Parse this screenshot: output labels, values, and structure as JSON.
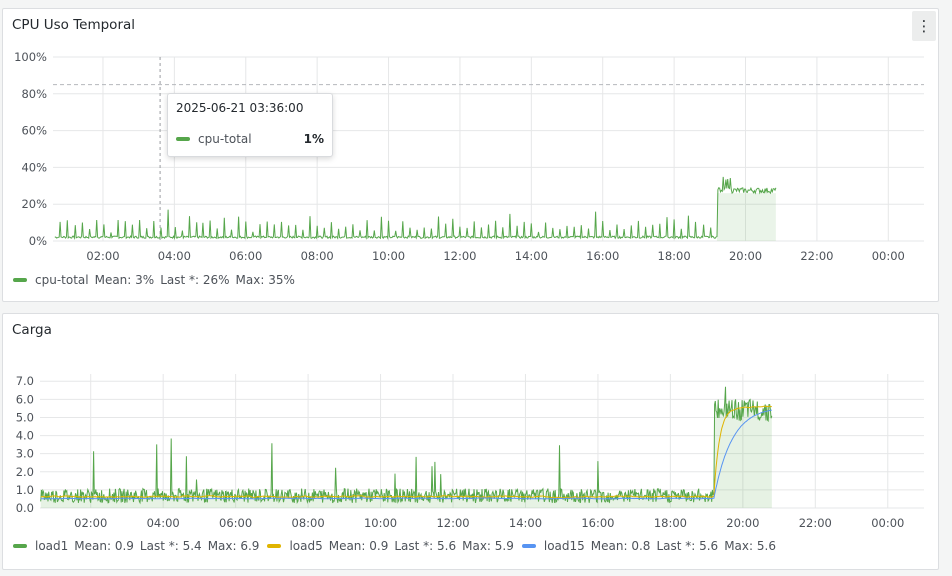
{
  "panel1": {
    "title": "CPU Uso Temporal",
    "menu_icon": "vertical-dots-icon",
    "tooltip": {
      "time": "2025-06-21 03:36:00",
      "series": "cpu-total",
      "value": "1%"
    },
    "legend": [
      {
        "name": "cpu-total",
        "color": "#56a64b",
        "mean": "Mean: 3%",
        "last": "Last *: 26%",
        "max": "Max: 35%"
      }
    ]
  },
  "panel2": {
    "title": "Carga",
    "legend": [
      {
        "name": "load1",
        "color": "#56a64b",
        "mean": "Mean: 0.9",
        "last": "Last *: 5.4",
        "max": "Max: 6.9"
      },
      {
        "name": "load5",
        "color": "#e0b400",
        "mean": "Mean: 0.9",
        "last": "Last *: 5.6",
        "max": "Max: 5.9"
      },
      {
        "name": "load15",
        "color": "#5794f2",
        "mean": "Mean: 0.8",
        "last": "Last *: 5.6",
        "max": "Max: 5.6"
      }
    ]
  },
  "chart_data": [
    {
      "type": "area",
      "title": "CPU Uso Temporal",
      "x_ticks": [
        "02:00",
        "04:00",
        "06:00",
        "08:00",
        "10:00",
        "12:00",
        "14:00",
        "16:00",
        "18:00",
        "20:00",
        "22:00",
        "00:00"
      ],
      "y_ticks": [
        "0%",
        "20%",
        "40%",
        "60%",
        "80%",
        "100%"
      ],
      "xlim": [
        0.6,
        25.0
      ],
      "ylim": [
        0,
        100
      ],
      "threshold": 85,
      "crosshair_x": 3.6,
      "grid": true,
      "legend_position": "bottom-left",
      "series": [
        {
          "name": "cpu-total",
          "color": "#56a64b",
          "baseline": 1.5,
          "spike_interval_hours": 0.2,
          "spike_heights": [
            10,
            12,
            8,
            14,
            9,
            16,
            11,
            7,
            13,
            10
          ],
          "high_period": {
            "start": 19.2,
            "end": 20.85,
            "level": 26,
            "max": 35
          }
        }
      ]
    },
    {
      "type": "area",
      "title": "Carga",
      "x_ticks": [
        "02:00",
        "04:00",
        "06:00",
        "08:00",
        "10:00",
        "12:00",
        "14:00",
        "16:00",
        "18:00",
        "20:00",
        "22:00",
        "00:00"
      ],
      "y_ticks": [
        "0.0",
        "1.0",
        "2.0",
        "3.0",
        "4.0",
        "5.0",
        "6.0",
        "7.0"
      ],
      "xlim": [
        0.6,
        25.0
      ],
      "ylim": [
        0,
        7.4
      ],
      "grid": true,
      "legend_position": "bottom-left",
      "series": [
        {
          "name": "load1",
          "color": "#56a64b",
          "baseline": 0.6,
          "high_start": 19.2,
          "high_end": 20.8,
          "high_level": 5.4,
          "max": 6.9
        },
        {
          "name": "load5",
          "color": "#e0b400",
          "baseline": 0.6,
          "high_start": 19.2,
          "high_end": 20.8,
          "high_level": 5.6,
          "max": 5.9
        },
        {
          "name": "load15",
          "color": "#5794f2",
          "baseline": 0.5,
          "high_start": 19.2,
          "high_end": 20.8,
          "high_level": 5.6,
          "max": 5.6
        }
      ]
    }
  ]
}
